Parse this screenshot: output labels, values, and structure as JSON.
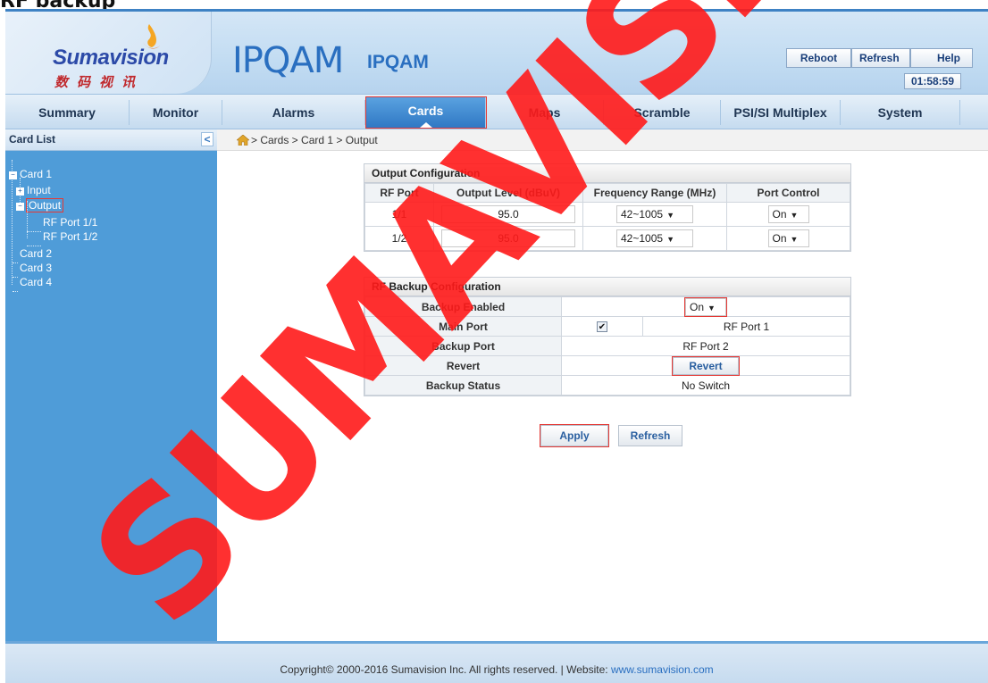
{
  "page": {
    "title": "RF backup"
  },
  "brand": {
    "logo_text": "Sumavision",
    "logo_cn": "数码视讯",
    "product_big": "IPQAM",
    "product_small": "IPQAM"
  },
  "header": {
    "buttons": {
      "reboot": "Reboot",
      "refresh": "Refresh",
      "help": "Help"
    },
    "clock": "01:58:59"
  },
  "nav": {
    "active": "Cards",
    "items": [
      "Summary",
      "Monitor",
      "Alarms",
      "Cards",
      "Maps",
      "Scramble",
      "PSI/SI Multiplex",
      "System"
    ]
  },
  "sidebar": {
    "title": "Card List",
    "collapse": "<",
    "tree": {
      "card1": "Card 1",
      "input": "Input",
      "output": "Output",
      "rf_port_1": "RF Port 1/1",
      "rf_port_2": "RF Port 1/2",
      "card2": "Card 2",
      "card3": "Card 3",
      "card4": "Card 4"
    }
  },
  "breadcrumb": "> Cards > Card 1 > Output",
  "output_config": {
    "title": "Output Configuration",
    "columns": [
      "RF Port",
      "Output Level (dBuV)",
      "Frequency Range (MHz)",
      "Port Control"
    ],
    "rows": [
      {
        "port": "1/1",
        "level": "95.0",
        "freq": "42~1005",
        "control": "On"
      },
      {
        "port": "1/2",
        "level": "95.0",
        "freq": "42~1005",
        "control": "On"
      }
    ]
  },
  "backup_config": {
    "title": "RF Backup Configuration",
    "backup_enabled_label": "Backup Enabled",
    "backup_enabled_value": "On",
    "main_port_label": "Main Port",
    "main_port_checked": true,
    "main_port_value": "RF Port 1",
    "backup_port_label": "Backup Port",
    "backup_port_value": "RF Port 2",
    "revert_label": "Revert",
    "revert_button": "Revert",
    "status_label": "Backup Status",
    "status_value": "No Switch"
  },
  "actions": {
    "apply": "Apply",
    "refresh": "Refresh"
  },
  "footer": {
    "copyright": "Copyright© 2000-2016 Sumavision Inc. All rights reserved. | Website: ",
    "website": "www.sumavision.com"
  },
  "watermark": "SUMAVISION",
  "colors": {
    "accent": "#2f78c4",
    "sidebar": "#4f9cd8",
    "highlight": "#e53935"
  }
}
